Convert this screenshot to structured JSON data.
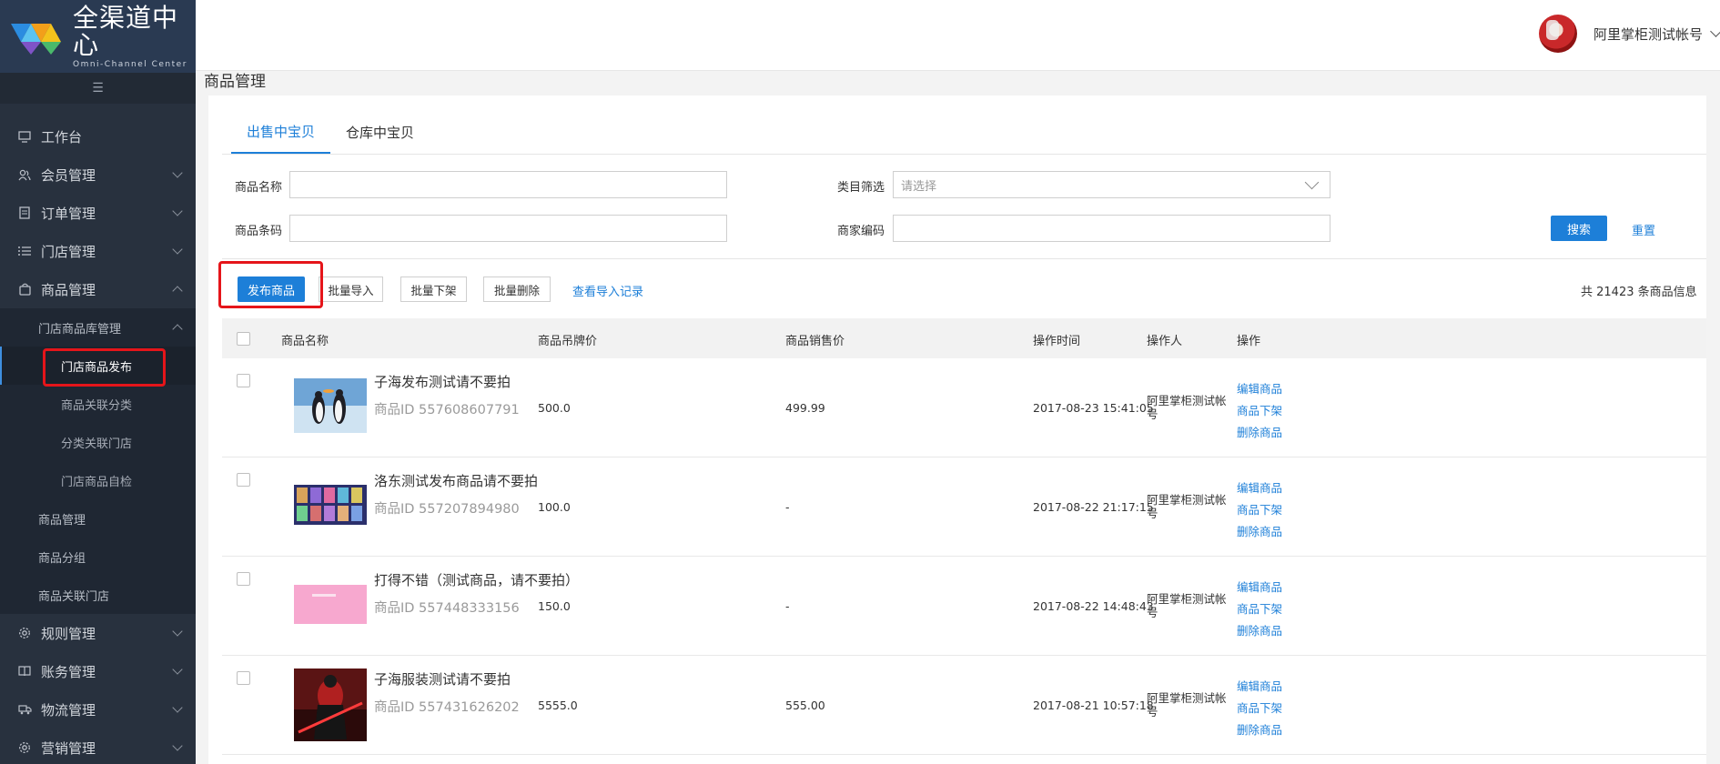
{
  "brand": {
    "title_cn": "全渠道中心",
    "title_en": "Omni-Channel Center"
  },
  "sidebar": {
    "collapse_icon": "menu-collapse-icon",
    "items": [
      {
        "label": "工作台",
        "icon": "monitor-icon"
      },
      {
        "label": "会员管理",
        "icon": "users-icon"
      },
      {
        "label": "订单管理",
        "icon": "order-icon"
      },
      {
        "label": "门店管理",
        "icon": "list-icon"
      },
      {
        "label": "商品管理",
        "icon": "bag-icon",
        "expanded": true
      }
    ],
    "goods_sub": {
      "group_label": "门店商品库管理",
      "group_items": [
        "门店商品发布",
        "商品关联分类",
        "分类关联门店",
        "门店商品自检"
      ],
      "active_item": "门店商品发布",
      "other_items": [
        "商品管理",
        "商品分组",
        "商品关联门店"
      ]
    },
    "bottom_items": [
      {
        "label": "规则管理",
        "icon": "gear-icon"
      },
      {
        "label": "账务管理",
        "icon": "book-icon"
      },
      {
        "label": "物流管理",
        "icon": "truck-icon"
      },
      {
        "label": "营销管理",
        "icon": "settings-icon"
      }
    ]
  },
  "header": {
    "user_name": "阿里掌柜测试帐号"
  },
  "page": {
    "title": "商品管理",
    "tabs": [
      "出售中宝贝",
      "仓库中宝贝"
    ],
    "active_tab": "出售中宝贝"
  },
  "filters": {
    "name_label": "商品名称",
    "name_value": "",
    "category_label": "类目筛选",
    "category_placeholder": "请选择",
    "barcode_label": "商品条码",
    "barcode_value": "",
    "merchant_code_label": "商家编码",
    "merchant_code_value": "",
    "search_label": "搜索",
    "reset_label": "重置"
  },
  "toolbar": {
    "publish_label": "发布商品",
    "batch_import_label": "批量导入",
    "batch_offshelf_label": "批量下架",
    "batch_delete_label": "批量删除",
    "import_log_label": "查看导入记录",
    "total_text": "共 21423 条商品信息"
  },
  "table": {
    "headers": [
      "商品名称",
      "商品吊牌价",
      "商品销售价",
      "操作时间",
      "操作人",
      "操作"
    ],
    "rows": [
      {
        "name": "子海发布测试请不要拍",
        "id_text": "商品ID 557608607791",
        "tag_price": "500.0",
        "sale_price": "499.99",
        "time": "2017-08-23 15:41:05",
        "operator": "阿里掌柜测试帐号",
        "thumb": "penguins"
      },
      {
        "name": "洛东测试发布商品请不要拍",
        "id_text": "商品ID 557207894980",
        "tag_price": "100.0",
        "sale_price": "-",
        "time": "2017-08-22 21:17:15",
        "operator": "阿里掌柜测试帐号",
        "thumb": "cards"
      },
      {
        "name": "打得不错（测试商品，请不要拍）",
        "id_text": "商品ID 557448333156",
        "tag_price": "150.0",
        "sale_price": "-",
        "time": "2017-08-22 14:48:43",
        "operator": "阿里掌柜测试帐号",
        "thumb": "pink"
      },
      {
        "name": "子海服装测试请不要拍",
        "id_text": "商品ID 557431626202",
        "tag_price": "5555.0",
        "sale_price": "555.00",
        "time": "2017-08-21 10:57:18",
        "operator": "阿里掌柜测试帐号",
        "thumb": "figure"
      }
    ],
    "actions": [
      "编辑商品",
      "商品下架",
      "删除商品"
    ]
  },
  "colors": {
    "accent": "#1d7fd8",
    "sidebar_bg": "#28313e",
    "highlight": "#e5151a"
  }
}
